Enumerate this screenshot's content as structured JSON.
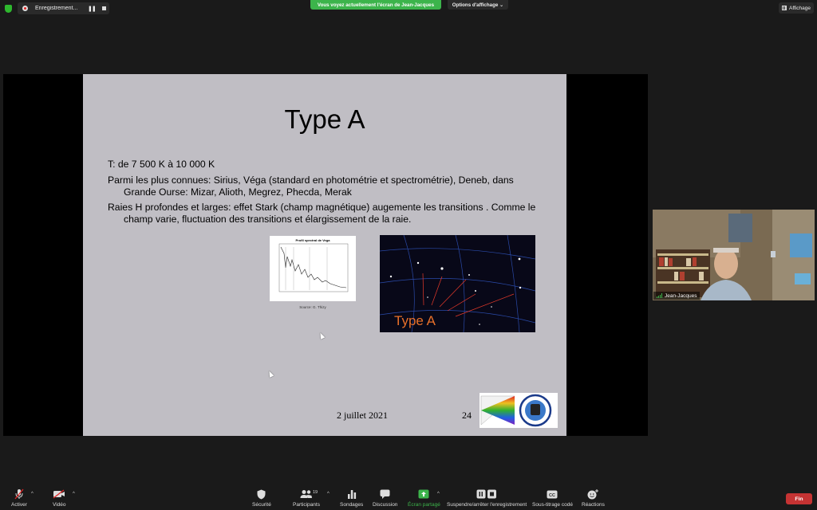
{
  "top_bar": {
    "recording_label": "Enregistrement...",
    "pause_symbol": "❚❚",
    "share_banner": "Vous voyez actuellement l'écran de Jean-Jacques",
    "view_options": "Options d'affichage ⌄",
    "display_label": "Affichage"
  },
  "slide": {
    "title": "Type A",
    "bullet1": "T: de 7 500 K à 10 000 K",
    "bullet2_line1": "Parmi les plus connues: Sirius, Véga (standard en photométrie et spectrométrie), Deneb, dans",
    "bullet2_line2": "Grande Ourse:  Mizar, Alioth, Megrez, Phecda, Merak",
    "bullet3_line1": "Raies H profondes et larges: effet Stark (champ magnétique) augemente les transitions . Comme le",
    "bullet3_line2": "champ varie, fluctuation des transitions et élargissement de la raie.",
    "spectrum_title": "Profil spectral de Vega",
    "spectrum_caption": "Source: G. Thizy",
    "stars_label": "Type A",
    "date": "2 juillet 2021",
    "page": "24"
  },
  "video": {
    "participant_name": "Jean-Jacques"
  },
  "toolbar": {
    "unmute": "Activer",
    "video": "Vidéo",
    "security": "Sécurité",
    "participants": "Participants",
    "participants_count": "19",
    "polls": "Sondages",
    "chat": "Discussion",
    "share": "Écran partagé",
    "record": "Suspendre/arrêter l'enregistrement",
    "captions": "Sous-titrage codé",
    "captions_glyph": "CC",
    "reactions": "Réactions",
    "end": "Fin"
  },
  "colors": {
    "share_green": "#3cb44b",
    "end_red": "#c53333",
    "stars_label": "#e8702a",
    "slide_bg": "#c0bec4"
  }
}
